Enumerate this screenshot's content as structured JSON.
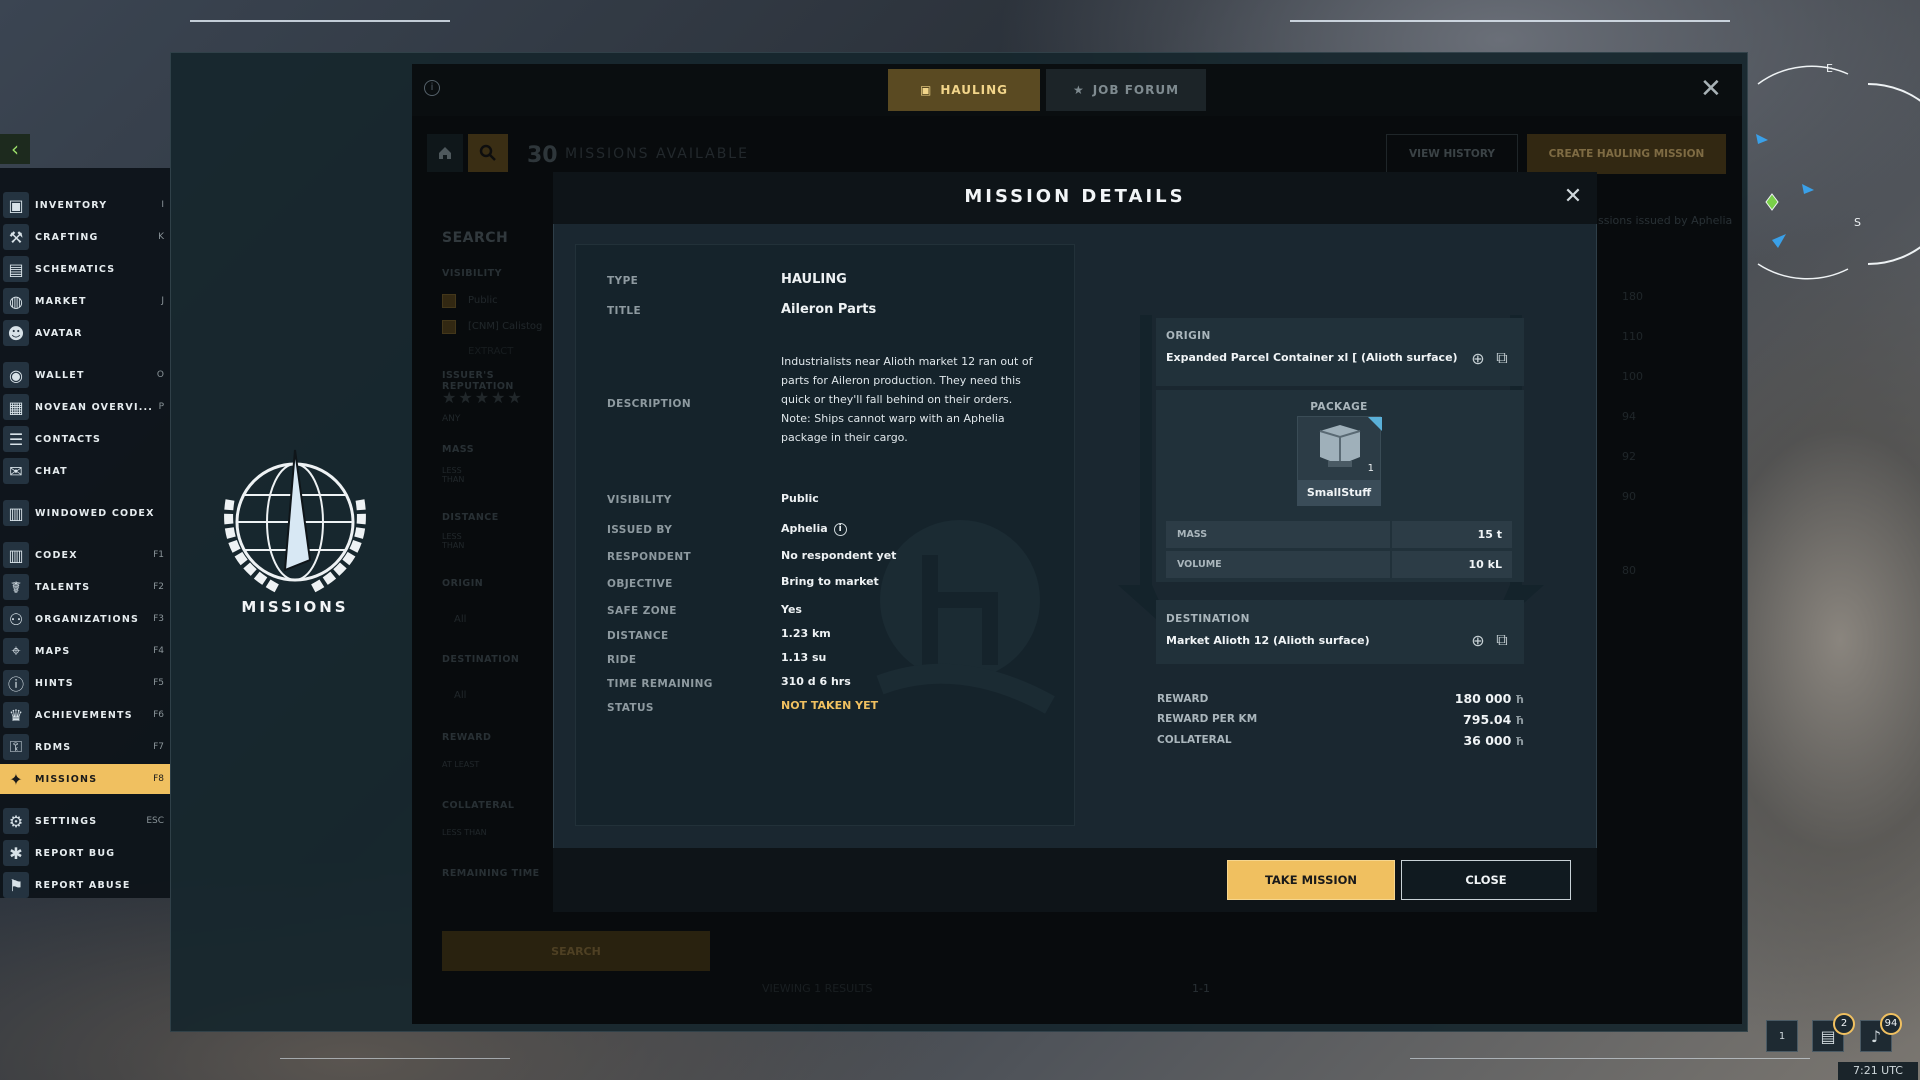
{
  "menu": {
    "items": [
      {
        "label": "INVENTORY",
        "key": "I",
        "icon": "cube-icon"
      },
      {
        "label": "CRAFTING",
        "key": "K",
        "icon": "hammer-icon"
      },
      {
        "label": "SCHEMATICS",
        "key": "",
        "icon": "blueprint-icon"
      },
      {
        "label": "MARKET",
        "key": "J",
        "icon": "globe-icon"
      },
      {
        "label": "AVATAR",
        "key": "",
        "icon": "person-icon"
      },
      {
        "label": "WALLET",
        "key": "O",
        "icon": "coin-icon"
      },
      {
        "label": "NOVEAN OVERVI...",
        "key": "P",
        "icon": "profile-card-icon"
      },
      {
        "label": "CONTACTS",
        "key": "",
        "icon": "contacts-icon"
      },
      {
        "label": "CHAT",
        "key": "",
        "icon": "chat-icon"
      },
      {
        "label": "WINDOWED CODEX",
        "key": "",
        "icon": "book-icon"
      },
      {
        "label": "CODEX",
        "key": "F1",
        "icon": "book-icon"
      },
      {
        "label": "TALENTS",
        "key": "F2",
        "icon": "talents-icon"
      },
      {
        "label": "ORGANIZATIONS",
        "key": "F3",
        "icon": "organization-icon"
      },
      {
        "label": "MAPS",
        "key": "F4",
        "icon": "map-icon"
      },
      {
        "label": "HINTS",
        "key": "F5",
        "icon": "info-icon"
      },
      {
        "label": "ACHIEVEMENTS",
        "key": "F6",
        "icon": "trophy-icon"
      },
      {
        "label": "RDMS",
        "key": "F7",
        "icon": "rdms-icon"
      },
      {
        "label": "MISSIONS",
        "key": "F8",
        "icon": "missions-icon"
      },
      {
        "label": "SETTINGS",
        "key": "ESC",
        "icon": "gear-icon"
      },
      {
        "label": "REPORT BUG",
        "key": "",
        "icon": "bug-icon"
      },
      {
        "label": "REPORT ABUSE",
        "key": "",
        "icon": "flag-icon"
      }
    ]
  },
  "panel": {
    "title": "MISSIONS"
  },
  "tabs": {
    "hauling": "HAULING",
    "job_forum": "JOB FORUM"
  },
  "toolbar": {
    "count": "30",
    "count_label": "MISSIONS AVAILABLE",
    "view_history": "VIEW HISTORY",
    "create": "CREATE HAULING MISSION"
  },
  "search": {
    "title": "SEARCH",
    "visibility_label": "VISIBILITY",
    "visibility_options": [
      "Public",
      "[CNM] Calistog",
      "EXTRACT"
    ],
    "reputation_label": "ISSUER'S REPUTATION",
    "reputation_value": "ANY",
    "mass_label": "MASS",
    "mass_placeholder": "LESS THAN",
    "distance_label": "DISTANCE",
    "distance_placeholder": "LESS THAN",
    "origin_label": "ORIGIN",
    "origin_value": "All",
    "destination_label": "DESTINATION",
    "destination_value": "All",
    "reward_label": "REWARD",
    "reward_placeholder": "AT LEAST",
    "collateral_label": "COLLATERAL",
    "collateral_placeholder": "LESS THAN",
    "remaining_label": "REMAINING TIME",
    "button": "SEARCH"
  },
  "results": {
    "issuer_note": "ssions issued by Aphelia",
    "rewards": [
      "180",
      "110",
      "100",
      "94",
      "92",
      "90",
      "80"
    ],
    "viewing": "VIEWING 1 RESULTS",
    "pages": "1-1"
  },
  "modal": {
    "title": "MISSION DETAILS",
    "fields": {
      "type_label": "TYPE",
      "type": "HAULING",
      "title_label": "TITLE",
      "title": "Aileron Parts",
      "description_label": "DESCRIPTION",
      "description": "Industrialists near Alioth market 12 ran out of parts for Aileron production. They need this quick or they'll fall behind on their orders. Note: Ships cannot warp with an Aphelia package in their cargo.",
      "visibility_label": "VISIBILITY",
      "visibility": "Public",
      "issued_by_label": "ISSUED BY",
      "issued_by": "Aphelia",
      "respondent_label": "RESPONDENT",
      "respondent": "No respondent yet",
      "objective_label": "OBJECTIVE",
      "objective": "Bring to market",
      "safe_zone_label": "SAFE ZONE",
      "safe_zone": "Yes",
      "distance_label": "DISTANCE",
      "distance": "1.23 km",
      "ride_label": "RIDE",
      "ride": "1.13 su",
      "time_remaining_label": "TIME REMAINING",
      "time_remaining": "310 d 6 hrs",
      "status_label": "STATUS",
      "status": "NOT TAKEN YET"
    },
    "route": {
      "origin_label": "ORIGIN",
      "origin": "Expanded Parcel Container xl [ (Alioth surface)",
      "package_label": "PACKAGE",
      "package_name": "SmallStuff",
      "package_qty": "1",
      "mass_label": "MASS",
      "mass": "15 t",
      "volume_label": "VOLUME",
      "volume": "10 kL",
      "destination_label": "DESTINATION",
      "destination": "Market Alioth 12 (Alioth surface)"
    },
    "reward": {
      "reward_label": "REWARD",
      "reward": "180 000",
      "per_km_label": "REWARD PER KM",
      "per_km": "795.04",
      "collateral_label": "COLLATERAL",
      "collateral": "36 000",
      "currency": "ħ"
    },
    "take_button": "TAKE MISSION",
    "close_button": "CLOSE"
  },
  "status_bar": {
    "slot": "1",
    "chat_count": "2",
    "notif_count": "94",
    "time": "7:21 UTC"
  },
  "colors": {
    "accent": "#f0c060",
    "status": "#f0c060",
    "radar": "#3aa0e8"
  }
}
